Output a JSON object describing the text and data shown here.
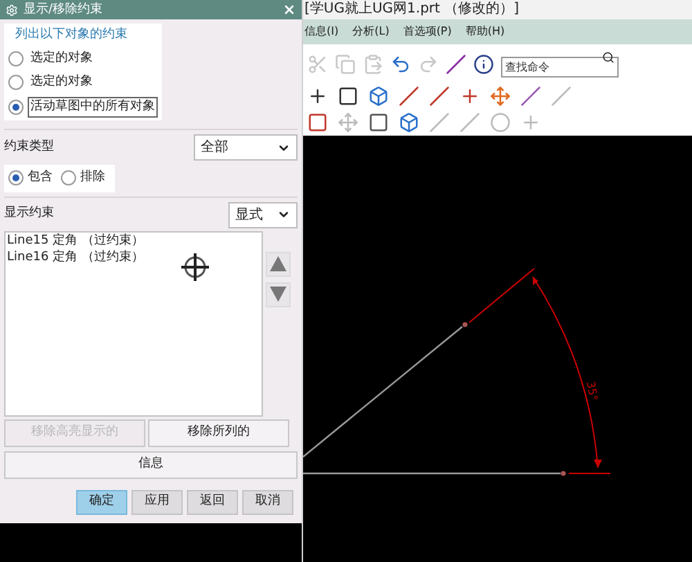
{
  "window": {
    "title": "[学UG就上UG网1.prt （修改的）]"
  },
  "menu": [
    {
      "label": "信息(I)"
    },
    {
      "label": "分析(L)"
    },
    {
      "label": "首选项(P)"
    },
    {
      "label": "帮助(H)"
    }
  ],
  "search": {
    "placeholder": "查找命令"
  },
  "dialog": {
    "title": "显示/移除约束",
    "list_group": {
      "title": "列出以下对象的约束",
      "options": [
        {
          "label": "选定的对象",
          "selected": false
        },
        {
          "label": "选定的对象",
          "selected": false
        },
        {
          "label": "活动草图中的所有对象",
          "selected": true
        }
      ]
    },
    "constraint_type": {
      "label": "约束类型",
      "value": "全部"
    },
    "filter": [
      {
        "label": "包含",
        "selected": true
      },
      {
        "label": "排除",
        "selected": false
      }
    ],
    "show_constraints": {
      "label": "显示约束",
      "value": "显式"
    },
    "constraints": [
      "Line15 定角 （过约束）",
      "Line16 定角 （过约束）"
    ],
    "action_buttons": [
      {
        "label": "移除高亮显示的",
        "disabled": true
      },
      {
        "label": "移除所列的",
        "disabled": false
      }
    ],
    "info_button": "信息",
    "footer_buttons": [
      {
        "label": "确定",
        "default": true
      },
      {
        "label": "应用",
        "default": false
      },
      {
        "label": "返回",
        "default": false
      },
      {
        "label": "取消",
        "default": false
      }
    ]
  },
  "canvas": {
    "dimension": "35°"
  }
}
